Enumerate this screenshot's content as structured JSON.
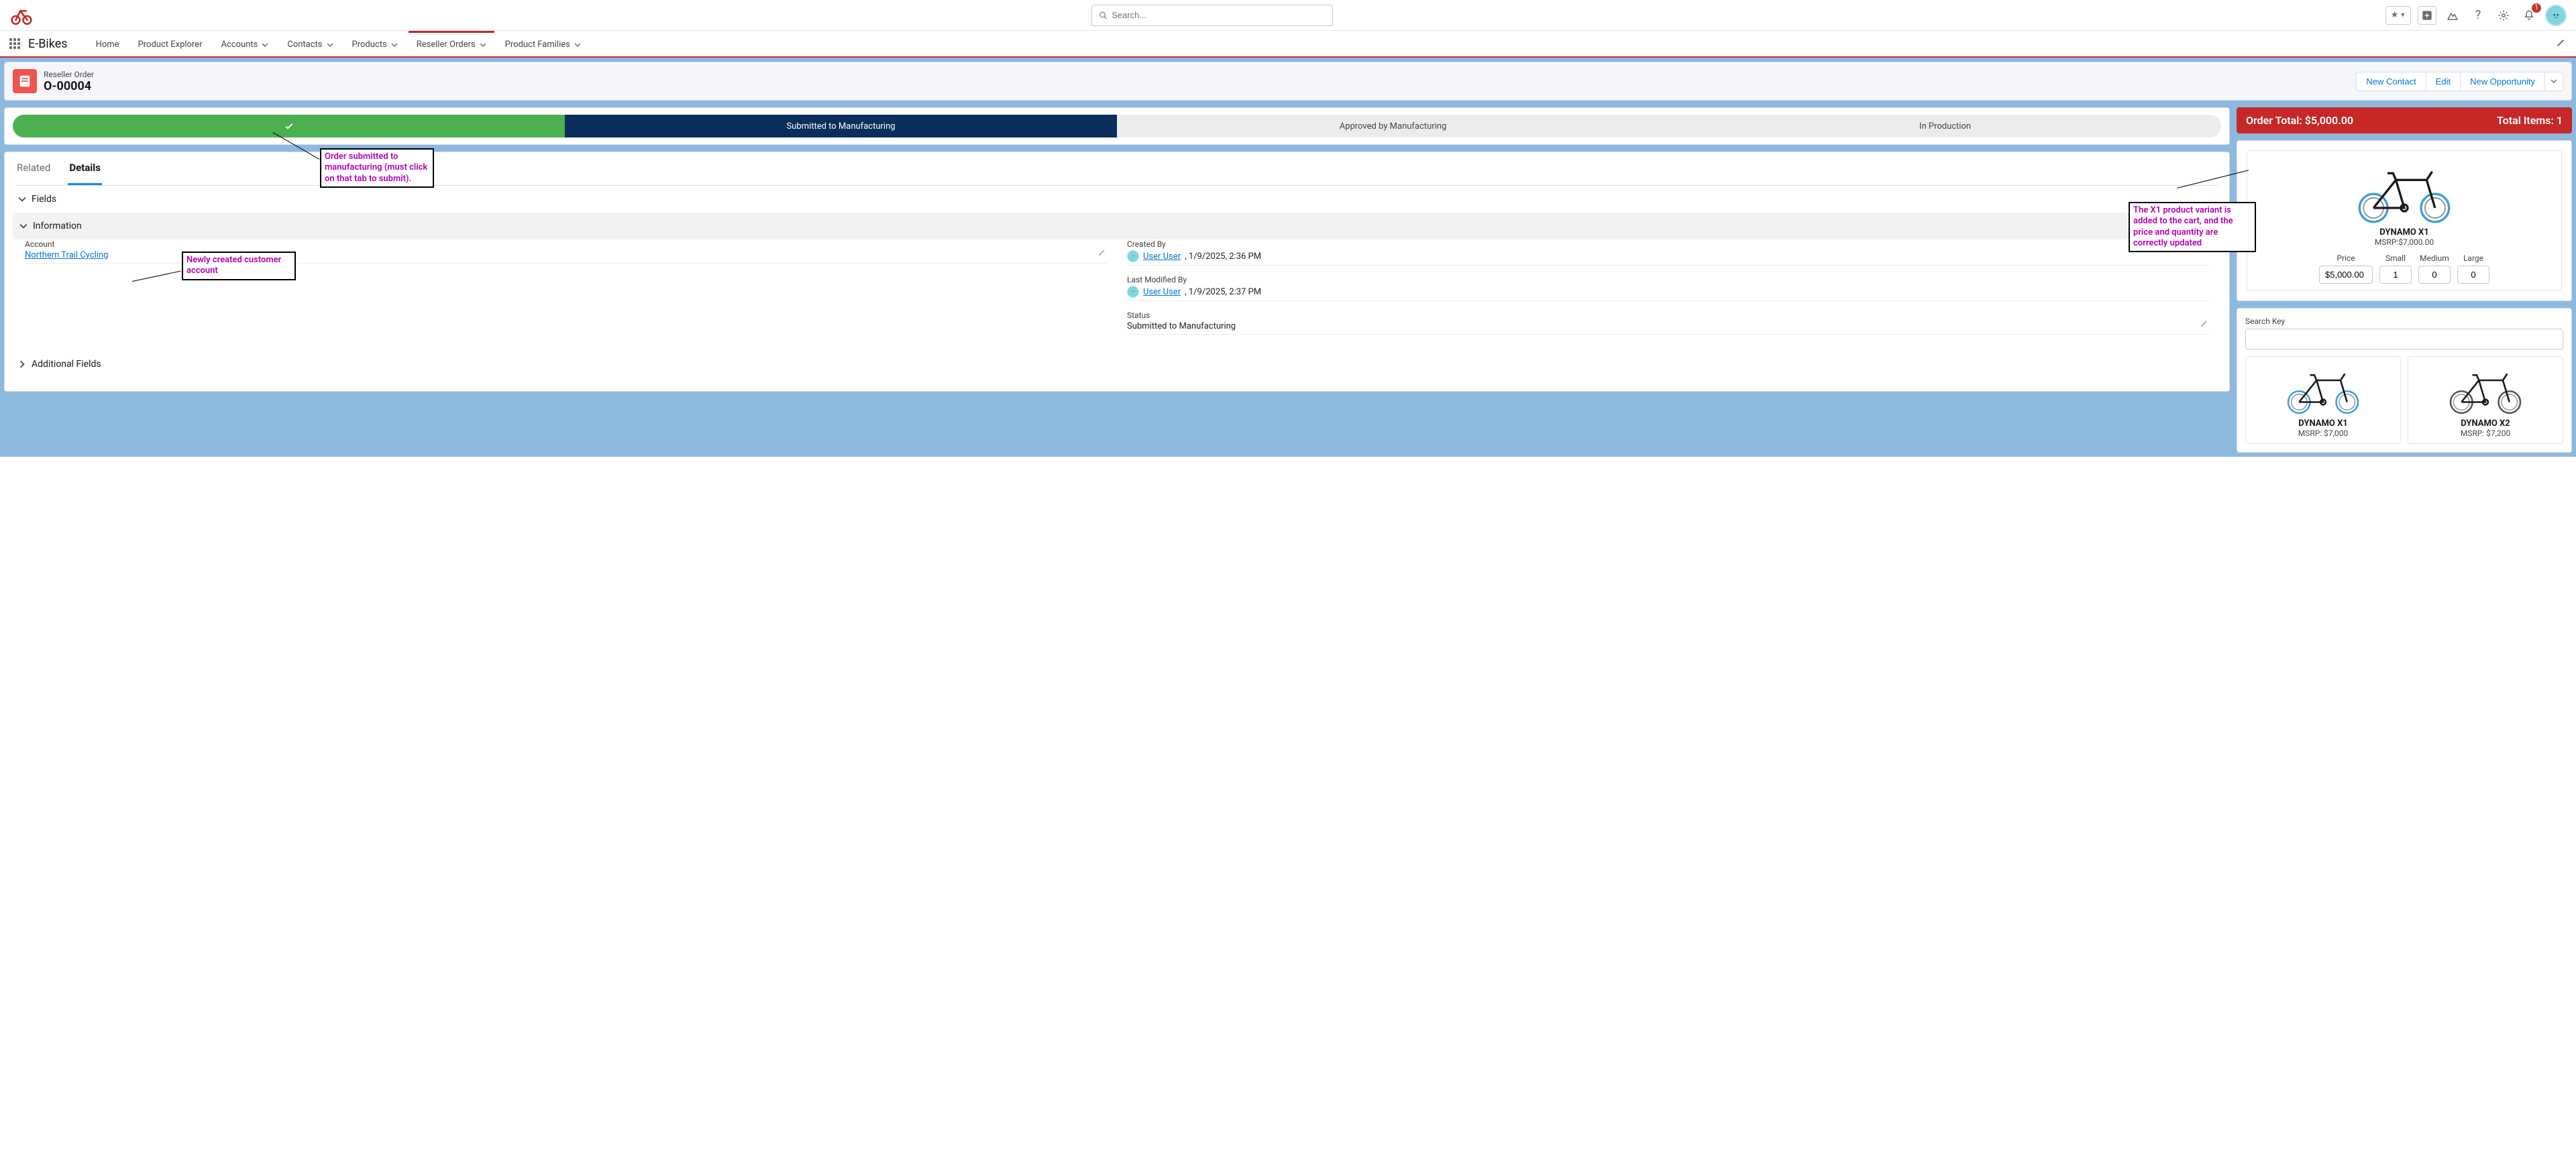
{
  "header": {
    "search_placeholder": "Search...",
    "notification_count": "1"
  },
  "nav": {
    "app_name": "E-Bikes",
    "tabs": [
      {
        "label": "Home",
        "dropdown": false,
        "active": false
      },
      {
        "label": "Product Explorer",
        "dropdown": false,
        "active": false
      },
      {
        "label": "Accounts",
        "dropdown": true,
        "active": false
      },
      {
        "label": "Contacts",
        "dropdown": true,
        "active": false
      },
      {
        "label": "Products",
        "dropdown": true,
        "active": false
      },
      {
        "label": "Reseller Orders",
        "dropdown": true,
        "active": true
      },
      {
        "label": "Product Families",
        "dropdown": true,
        "active": false
      }
    ]
  },
  "record": {
    "object_type": "Reseller Order",
    "name": "O-00004",
    "actions": {
      "new_contact": "New Contact",
      "edit": "Edit",
      "new_opportunity": "New Opportunity"
    }
  },
  "path": {
    "steps": [
      {
        "label": "",
        "state": "complete"
      },
      {
        "label": "Submitted to Manufacturing",
        "state": "current"
      },
      {
        "label": "Approved by Manufacturing",
        "state": "future"
      },
      {
        "label": "In Production",
        "state": "future"
      }
    ]
  },
  "detail_tabs": {
    "related": "Related",
    "details": "Details"
  },
  "sections": {
    "fields": "Fields",
    "information": "Information",
    "additional": "Additional Fields"
  },
  "fields": {
    "account_label": "Account",
    "account_value": "Northern Trail Cycling",
    "created_by_label": "Created By",
    "created_by_user": "User User",
    "created_by_ts": ", 1/9/2025, 2:36 PM",
    "modified_by_label": "Last Modified By",
    "modified_by_user": "User User",
    "modified_by_ts": ", 1/9/2025, 2:37 PM",
    "status_label": "Status",
    "status_value": "Submitted to Manufacturing"
  },
  "annotations": {
    "submitted": "Order submitted to manufacturing (must click on that tab to submit).",
    "account": "Newly created customer account",
    "cart": "The X1 product variant is added to the cart, and the price and quantity are correctly updated"
  },
  "order_totals": {
    "total_label": "Order Total: $5,000.00",
    "items_label": "Total Items: 1"
  },
  "cart_item": {
    "name": "DYNAMO X1",
    "msrp": "MSRP:$7,000.00",
    "labels": {
      "price": "Price",
      "small": "Small",
      "medium": "Medium",
      "large": "Large"
    },
    "values": {
      "price": "$5,000.00",
      "small": "1",
      "medium": "0",
      "large": "0"
    }
  },
  "search": {
    "label": "Search Key",
    "value": ""
  },
  "products": [
    {
      "name": "DYNAMO X1",
      "msrp": "MSRP: $7,000"
    },
    {
      "name": "DYNAMO X2",
      "msrp": "MSRP: $7,200"
    }
  ]
}
